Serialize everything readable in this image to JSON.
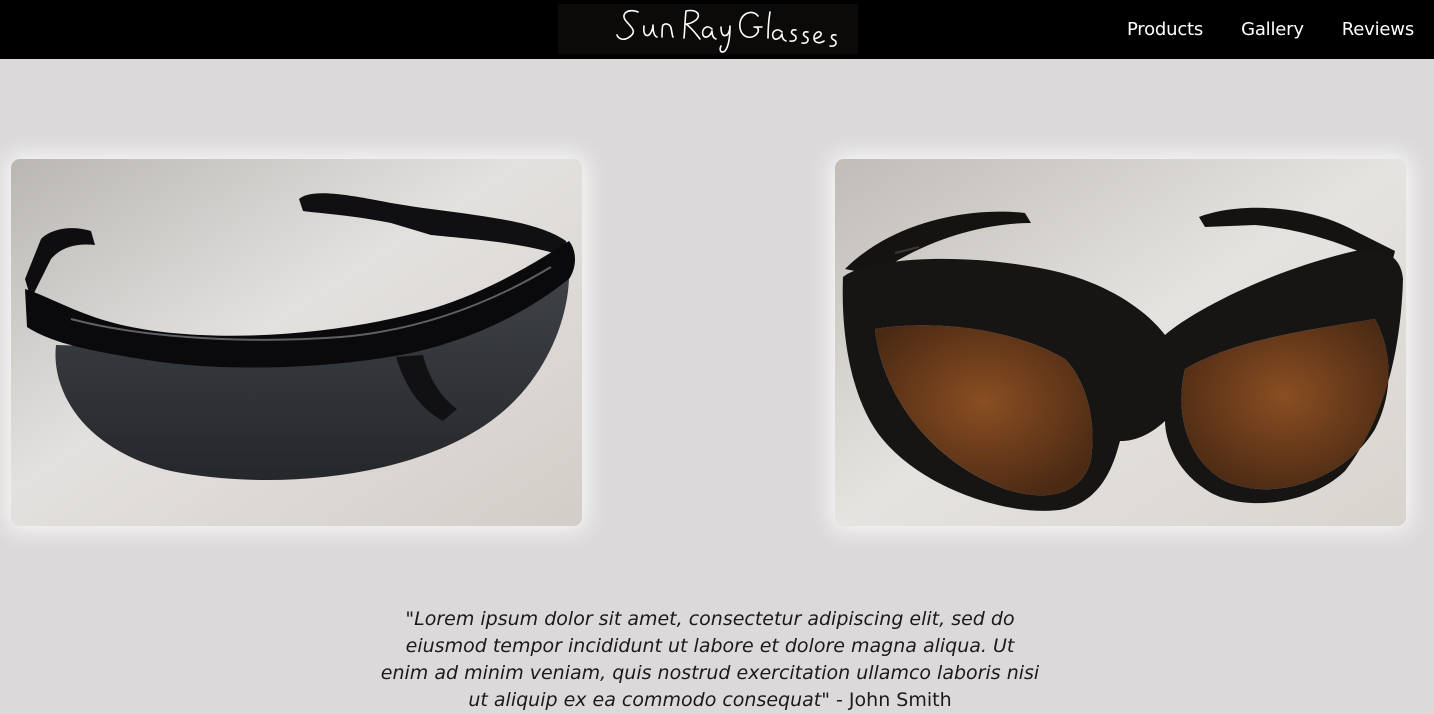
{
  "brand": {
    "logo_text": "Sun Ray Glasses",
    "logo_bg": "#0b0a08"
  },
  "nav": {
    "items": [
      {
        "label": "Products"
      },
      {
        "label": "Gallery"
      },
      {
        "label": "Reviews"
      }
    ]
  },
  "gallery": {
    "images": [
      {
        "subject": "black wraparound sunglasses with dark grey lenses"
      },
      {
        "subject": "black sport sunglasses with brown lenses"
      }
    ]
  },
  "review": {
    "quote": "\"Lorem ipsum dolor sit amet, consectetur adipiscing elit, sed do eiusmod tempor incididunt ut labore et dolore magna aliqua. Ut enim ad minim veniam, quis nostrud exercitation ullamco laboris nisi ut aliquip ex ea commodo consequat\"",
    "author": " - John Smith"
  },
  "colors": {
    "page_bg": "#dbd9da",
    "navbar_bg": "#000000",
    "nav_text": "#ffffff",
    "body_text": "#1a1a1a"
  }
}
